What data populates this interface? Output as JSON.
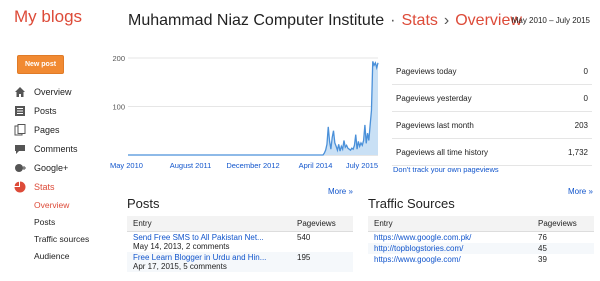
{
  "brand": "My blogs",
  "header": {
    "blog_title": "Muhammad Niaz Computer Institute",
    "sep": "·",
    "crumb1": "Stats",
    "chevron": "›",
    "crumb2": "Overview",
    "date_range": "May 2010 – July 2015"
  },
  "sidebar": {
    "new_post": "New post",
    "items": [
      {
        "label": "Overview",
        "icon": "home-icon"
      },
      {
        "label": "Posts",
        "icon": "posts-icon"
      },
      {
        "label": "Pages",
        "icon": "pages-icon"
      },
      {
        "label": "Comments",
        "icon": "comments-icon"
      },
      {
        "label": "Google+",
        "icon": "google-plus-icon"
      },
      {
        "label": "Stats",
        "icon": "stats-icon"
      }
    ],
    "subitems": [
      "Overview",
      "Posts",
      "Traffic sources",
      "Audience"
    ]
  },
  "chart_data": {
    "type": "area",
    "x_ticks": [
      "May 2010",
      "August 2011",
      "December 2012",
      "April 2014",
      "July 2015"
    ],
    "y_ticks": [
      100,
      200
    ],
    "ylim": [
      0,
      200
    ],
    "color": "#4a90d9",
    "values": [
      0,
      0,
      0,
      0,
      0,
      0,
      0,
      0,
      0,
      0,
      0,
      0,
      0,
      0,
      0,
      0,
      0,
      0,
      0,
      0,
      0,
      0,
      0,
      0,
      0,
      0,
      0,
      0,
      0,
      0,
      0,
      0,
      0,
      0,
      0,
      0,
      0,
      0,
      0,
      0,
      0,
      0,
      0,
      0,
      0,
      0,
      0,
      0,
      0,
      0,
      0,
      0,
      0,
      0,
      0,
      0,
      0,
      0,
      0,
      0,
      0,
      0,
      0,
      0,
      0,
      0,
      0,
      0,
      0,
      0,
      0,
      0,
      0,
      0,
      0,
      0,
      0,
      0,
      0,
      0,
      0,
      0,
      0,
      0,
      0,
      0,
      0,
      0,
      0,
      0,
      0,
      0,
      0,
      0,
      0,
      0,
      0,
      0,
      0,
      0,
      0,
      0,
      0,
      0,
      0,
      0,
      0,
      0,
      0,
      0,
      0,
      0,
      0,
      0,
      0,
      0,
      0,
      0,
      0,
      0,
      0,
      0,
      0,
      0,
      0,
      0,
      0,
      0,
      0,
      0,
      0,
      0,
      0,
      0,
      0,
      0,
      0,
      0,
      0,
      0,
      0,
      0,
      0,
      0,
      0,
      0,
      0,
      0,
      0,
      0,
      4,
      10,
      22,
      58,
      28,
      12,
      36,
      50,
      25,
      18,
      10,
      22,
      8,
      18,
      12,
      30,
      16,
      20,
      14,
      12,
      10,
      14,
      12,
      20,
      42,
      12,
      28,
      18,
      25,
      20,
      30,
      62,
      24,
      45,
      30,
      62,
      92,
      193,
      185,
      190,
      180,
      190
    ]
  },
  "stats": [
    {
      "label": "Pageviews today",
      "value": "0"
    },
    {
      "label": "Pageviews yesterday",
      "value": "0"
    },
    {
      "label": "Pageviews last month",
      "value": "203"
    },
    {
      "label": "Pageviews all time history",
      "value": "1,732"
    }
  ],
  "dont_track": "Don't track your own pageviews",
  "more1": "More »",
  "more2": "More »",
  "posts": {
    "title": "Posts",
    "col1": "Entry",
    "col2": "Pageviews",
    "rows": [
      {
        "title": "Send Free SMS to All Pakistan Net...",
        "meta": "May 14, 2013, 2 comments",
        "views": "540"
      },
      {
        "title": "Free Learn Blogger in Urdu and Hin...",
        "meta": "Apr 17, 2015, 5 comments",
        "views": "195"
      }
    ]
  },
  "traffic": {
    "title": "Traffic Sources",
    "col1": "Entry",
    "col2": "Pageviews",
    "rows": [
      {
        "url": "https://www.google.com.pk/",
        "views": "76"
      },
      {
        "url": "http://topblogstories.com/",
        "views": "45"
      },
      {
        "url": "https://www.google.com/",
        "views": "39"
      }
    ]
  }
}
